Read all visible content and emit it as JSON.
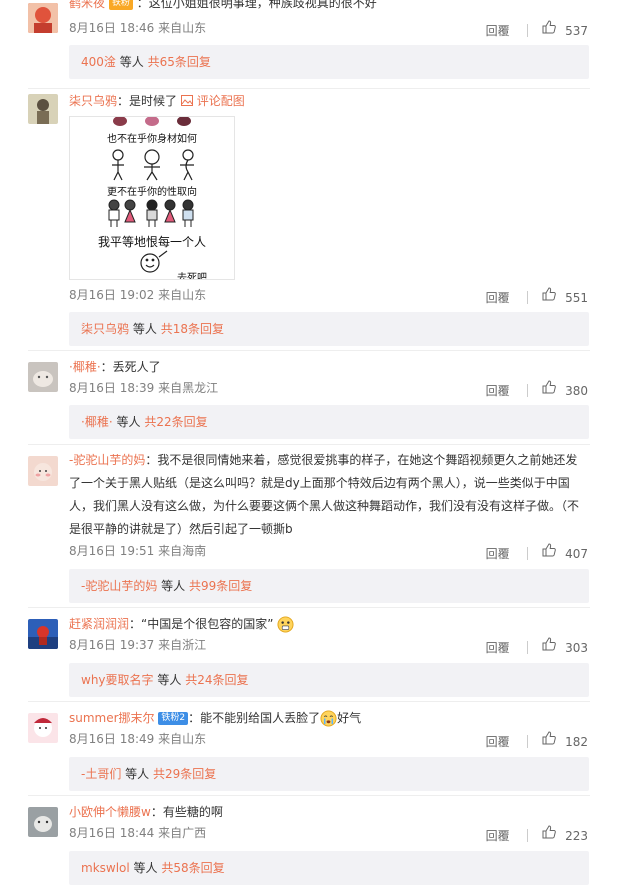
{
  "comments": [
    {
      "user": "鹤米夜",
      "badge": "铁粉",
      "text": "：这位小姐姐很明事理，种族歧视真的很不好",
      "date": "8月16日 18:46",
      "location": "来自山东",
      "reply_label": "回覆",
      "likes": "537",
      "thread": {
        "user": "400淦",
        "middle": "等人",
        "count": "共65条回复"
      }
    },
    {
      "user": "柒只乌鸦",
      "text": "：是时候了",
      "link": "评论配图",
      "meme_lines": [
        "也不在乎你身材如何",
        "更不在乎你的性取向",
        "我平等地恨每一个人",
        "去死吧"
      ],
      "date": "8月16日 19:02",
      "location": "来自山东",
      "reply_label": "回覆",
      "likes": "551",
      "thread": {
        "user": "柒只乌鸦",
        "middle": "等人",
        "count": "共18条回复"
      }
    },
    {
      "user": "·椰稚·",
      "text": "：丢死人了",
      "date": "8月16日 18:39",
      "location": "来自黑龙江",
      "reply_label": "回覆",
      "likes": "380",
      "thread": {
        "user": "·椰稚·",
        "middle": "等人",
        "count": "共22条回复"
      }
    },
    {
      "user": "-驼驼山芋的妈",
      "text": "：我不是很同情她来着，感觉很爱挑事的样子，在她这个舞蹈视频更久之前她还发了一个关于黑人贴纸（是这么叫吗？就是dy上面那个特效后边有两个黑人），说一些类似于中国人，我们黑人没有这么做，为什么要要这俩个黑人做这种舞蹈动作，我们没有没有这样子做。（不是很平静的讲就是了）然后引起了一顿撕b",
      "date": "8月16日 19:51",
      "location": "来自海南",
      "reply_label": "回覆",
      "likes": "407",
      "thread": {
        "user": "-驼驼山芋的妈",
        "middle": "等人",
        "count": "共99条回复"
      }
    },
    {
      "user": "赶紧润润润",
      "text": "：“中国是个很包容的国家”",
      "date": "8月16日 19:37",
      "location": "来自浙江",
      "reply_label": "回覆",
      "likes": "303",
      "thread": {
        "user": "why要取名字",
        "middle": "等人",
        "count": "共24条回复"
      }
    },
    {
      "user": "summer挪末尔",
      "badge": "铁粉2",
      "text": "：能不能别给国人丢脸了",
      "text_after": "好气",
      "date": "8月16日 18:49",
      "location": "来自山东",
      "reply_label": "回覆",
      "likes": "182",
      "thread": {
        "user": "-土哥们",
        "middle": "等人",
        "count": "共29条回复"
      }
    },
    {
      "user": "小欧伸个懒腰w",
      "text": "：有些糖的啊",
      "date": "8月16日 18:44",
      "location": "来自广西",
      "reply_label": "回覆",
      "likes": "223",
      "thread": {
        "user": "mkswlol",
        "middle": "等人",
        "count": "共58条回复"
      }
    }
  ],
  "colors": {
    "accent": "#eb7350",
    "thread_bg": "#f2f2f5",
    "meta": "#808080"
  }
}
